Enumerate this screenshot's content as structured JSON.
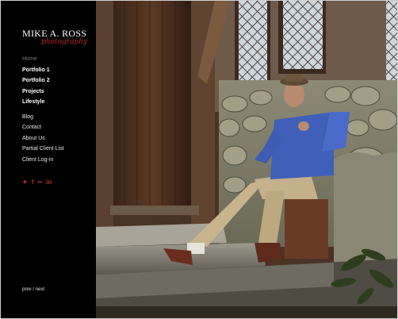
{
  "brand": {
    "name": "MIKE A. ROSS",
    "tagline": "photography"
  },
  "nav": {
    "home": "Home",
    "portfolios": [
      "Portfolio 1",
      "Portfolio 2",
      "Projects",
      "Lifestyle"
    ],
    "pages": [
      "Blog",
      "Contact",
      "About Us",
      "Partial Client List",
      "Client Log-in"
    ]
  },
  "social": {
    "icons": [
      "twitter-icon",
      "facebook-icon",
      "flickr-icon",
      "linkedin-icon"
    ],
    "glyphs": [
      "✦",
      "f",
      "••",
      "in"
    ]
  },
  "pager": {
    "prev": "prev",
    "separator": " / ",
    "next": "next"
  },
  "colors": {
    "accent": "#c0282a",
    "background": "#000000"
  }
}
